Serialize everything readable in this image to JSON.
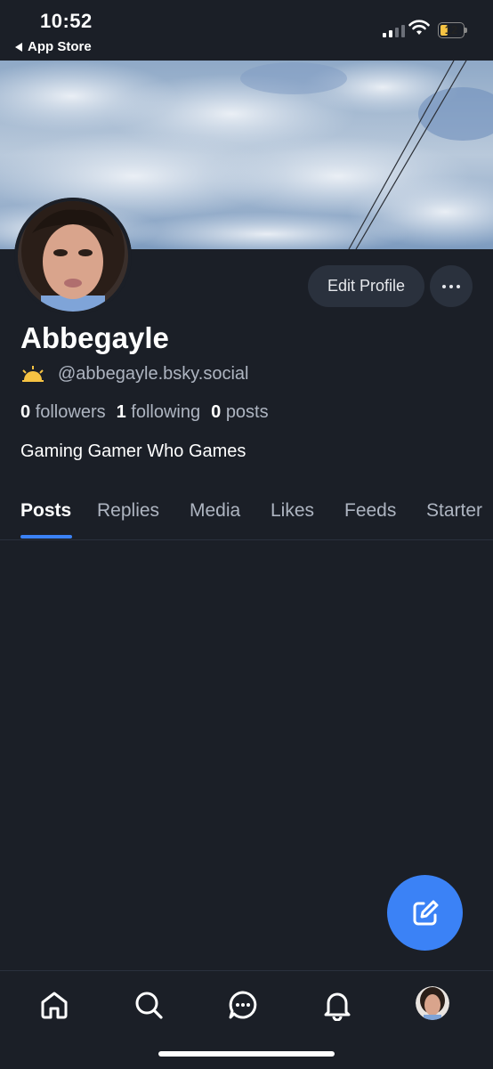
{
  "status_bar": {
    "time": "10:52",
    "back_label": "App Store",
    "battery_level": "12"
  },
  "profile": {
    "display_name": "Abbegayle",
    "handle": "@abbegayle.bsky.social",
    "followers_count": "0",
    "followers_label": "followers",
    "following_count": "1",
    "following_label": "following",
    "posts_count": "0",
    "posts_label": "posts",
    "bio": "Gaming Gamer Who Games",
    "edit_profile_label": "Edit Profile"
  },
  "tabs": [
    {
      "label": "Posts",
      "active": true
    },
    {
      "label": "Replies",
      "active": false
    },
    {
      "label": "Media",
      "active": false
    },
    {
      "label": "Likes",
      "active": false
    },
    {
      "label": "Feeds",
      "active": false
    },
    {
      "label": "Starter",
      "active": false
    }
  ],
  "colors": {
    "background": "#1b1f27",
    "accent": "#3b82f6",
    "button_bg": "#2a313d",
    "muted_text": "#aeb5c1",
    "sun_emoji": "#f6c343"
  },
  "icons": {
    "fab": "compose-icon",
    "nav": [
      "home-icon",
      "search-icon",
      "chat-icon",
      "bell-icon",
      "profile-avatar"
    ]
  }
}
